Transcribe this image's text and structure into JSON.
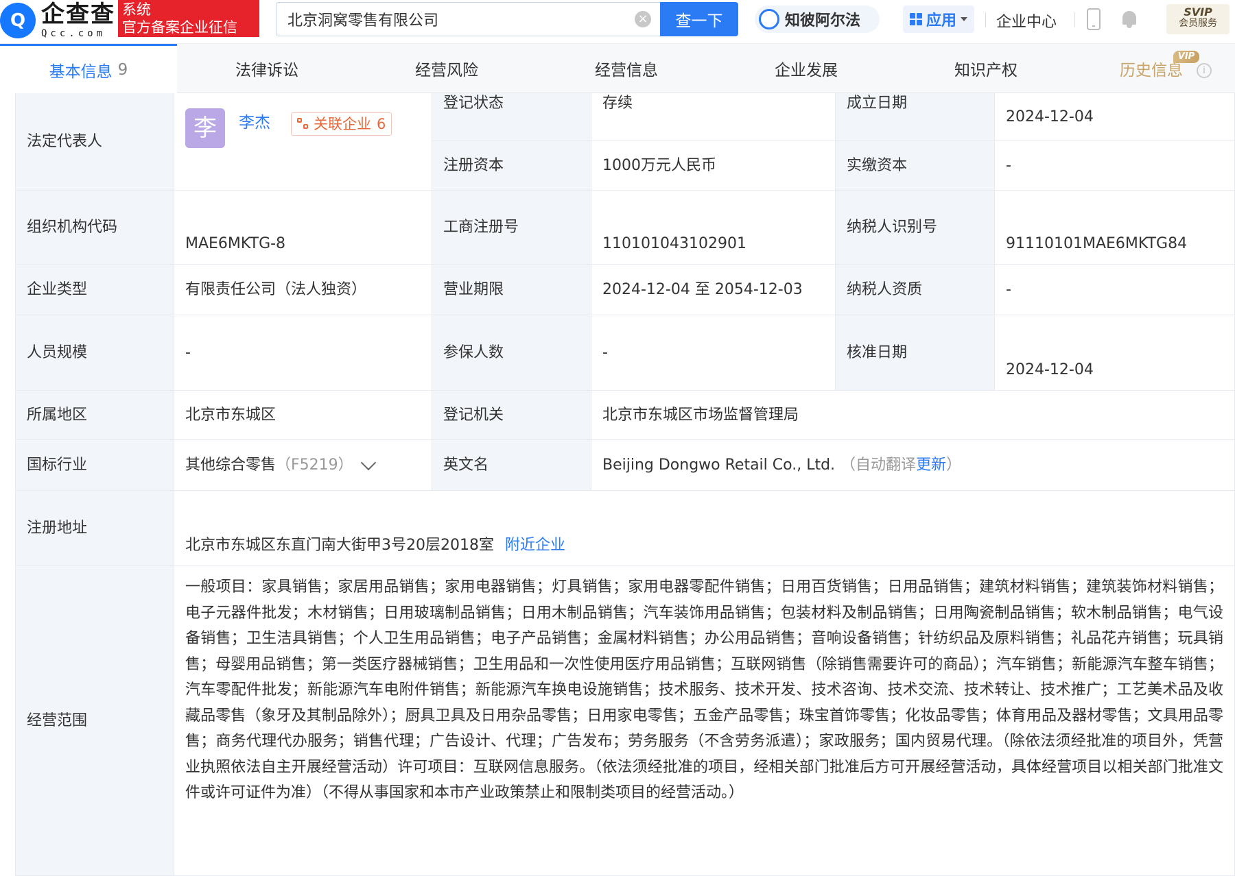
{
  "header": {
    "logo_cn": "企查查",
    "logo_en": "Qcc.com",
    "badge_line1": "系统",
    "badge_line2": "官方备案企业征信",
    "search_value": "北京洞窝零售有限公司",
    "search_button": "查一下",
    "zhibiaer": "知彼阿尔法",
    "apps": "应用",
    "enterprise_center": "企业中心",
    "svip_line1": "SVIP",
    "svip_line2": "会员服务"
  },
  "tabs": [
    {
      "label": "基本信息",
      "count": "9"
    },
    {
      "label": "法律诉讼"
    },
    {
      "label": "经营风险"
    },
    {
      "label": "经营信息"
    },
    {
      "label": "企业发展"
    },
    {
      "label": "知识产权"
    },
    {
      "label": "历史信息",
      "badge": "VIP"
    }
  ],
  "table": {
    "legal_rep": {
      "label": "法定代表人",
      "avatar": "李",
      "name": "李杰",
      "related_label": "关联企业",
      "related_count": "6"
    },
    "reg_status": {
      "label": "登记状态",
      "value": "存续"
    },
    "established": {
      "label": "成立日期",
      "value": "2024-12-04"
    },
    "reg_capital": {
      "label": "注册资本",
      "value": "1000万元人民币"
    },
    "paid_capital": {
      "label": "实缴资本",
      "value": "-"
    },
    "org_code": {
      "label": "组织机构代码",
      "value": "MAE6MKTG-8"
    },
    "biz_reg_no": {
      "label": "工商注册号",
      "value": "110101043102901"
    },
    "taxpayer_id": {
      "label": "纳税人识别号",
      "value": "91110101MAE6MKTG84"
    },
    "company_type": {
      "label": "企业类型",
      "value": "有限责任公司（法人独资）"
    },
    "biz_term": {
      "label": "营业期限",
      "value": "2024-12-04 至 2054-12-03"
    },
    "taxpayer_qual": {
      "label": "纳税人资质",
      "value": "-"
    },
    "staff_size": {
      "label": "人员规模",
      "value": "-"
    },
    "insured": {
      "label": "参保人数",
      "value": "-"
    },
    "approved_date": {
      "label": "核准日期",
      "value": "2024-12-04"
    },
    "region": {
      "label": "所属地区",
      "value": "北京市东城区"
    },
    "reg_authority": {
      "label": "登记机关",
      "value": "北京市东城区市场监督管理局"
    },
    "industry": {
      "label": "国标行业",
      "value": "其他综合零售",
      "code": "（F5219）"
    },
    "english_name": {
      "label": "英文名",
      "value": "Beijing Dongwo Retail Co., Ltd.",
      "note_open": "（自动翻译",
      "update": "更新",
      "note_close": "）"
    },
    "reg_address": {
      "label": "注册地址",
      "value": "北京市东城区东直门南大街甲3号20层2018室",
      "nearby": "附近企业"
    },
    "biz_scope": {
      "label": "经营范围",
      "value": "一般项目：家具销售；家居用品销售；家用电器销售；灯具销售；家用电器零配件销售；日用百货销售；日用品销售；建筑材料销售；建筑装饰材料销售；电子元器件批发；木材销售；日用玻璃制品销售；日用木制品销售；汽车装饰用品销售；包装材料及制品销售；日用陶瓷制品销售；软木制品销售；电气设备销售；卫生洁具销售；个人卫生用品销售；电子产品销售；金属材料销售；办公用品销售；音响设备销售；针纺织品及原料销售；礼品花卉销售；玩具销售；母婴用品销售；第一类医疗器械销售；卫生用品和一次性使用医疗用品销售；互联网销售（除销售需要许可的商品）；汽车销售；新能源汽车整车销售；汽车零配件批发；新能源汽车电附件销售；新能源汽车换电设施销售；技术服务、技术开发、技术咨询、技术交流、技术转让、技术推广；工艺美术品及收藏品零售（象牙及其制品除外）；厨具卫具及日用杂品零售；日用家电零售；五金产品零售；珠宝首饰零售；化妆品零售；体育用品及器材零售；文具用品零售；商务代理代办服务；销售代理；广告设计、代理；广告发布；劳务服务（不含劳务派遣）；家政服务；国内贸易代理。（除依法须经批准的项目外，凭营业执照依法自主开展经营活动）许可项目：互联网信息服务。（依法须经批准的项目，经相关部门批准后方可开展经营活动，具体经营项目以相关部门批准文件或许可证件为准）（不得从事国家和本市产业政策禁止和限制类项目的经营活动。）"
    }
  }
}
